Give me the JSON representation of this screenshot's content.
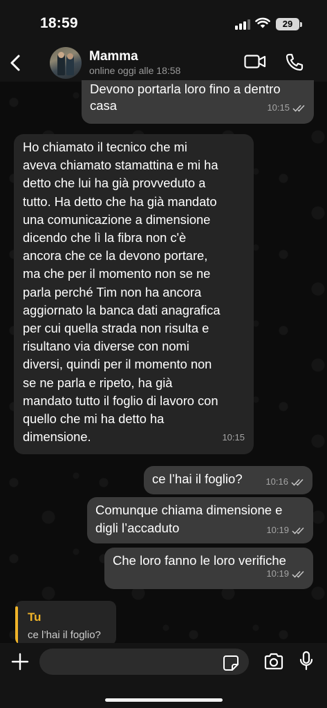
{
  "status_bar": {
    "time": "18:59",
    "battery": "29",
    "icons": [
      "signal-icon",
      "wifi-icon",
      "battery-icon"
    ]
  },
  "header": {
    "contact_name": "Mamma",
    "contact_status": "online oggi alle 18:58",
    "icons": [
      "back-icon",
      "avatar",
      "video-call-icon",
      "phone-call-icon"
    ]
  },
  "messages": [
    {
      "direction": "out",
      "lines": [
        "Devono portarla loro fino a dentro",
        "casa"
      ],
      "time": "10:15",
      "read": true
    },
    {
      "direction": "in",
      "lines": [
        "Ho chiamato il tecnico che mi",
        "aveva chiamato stamattina e mi ha",
        "detto che lui ha già provveduto a",
        "tutto. Ha detto che ha già mandato",
        "una comunicazione a dimensione",
        "dicendo che lì la fibra non c'è",
        "ancora che ce la devono portare,",
        "ma che per il momento non se ne",
        "parla perché Tim non ha ancora",
        "aggiornato la banca dati anagrafica",
        "per cui quella strada non risulta e",
        "risultano via diverse con nomi",
        "diversi, quindi per il momento non",
        "se ne parla e ripeto, ha già",
        "mandato tutto il foglio di lavoro con",
        "quello che mi ha detto ha",
        "dimensione."
      ],
      "time": "10:15"
    },
    {
      "direction": "out",
      "lines": [
        "ce l’hai il foglio?"
      ],
      "time": "10:16",
      "read": true
    },
    {
      "direction": "out",
      "lines": [
        "Comunque chiama dimensione e",
        "digli l’accaduto"
      ],
      "time": "10:19",
      "read": true
    },
    {
      "direction": "out",
      "lines": [
        "Che loro fanno le loro verifiche"
      ],
      "time": "10:19",
      "read": true
    }
  ],
  "reply_preview": {
    "author": "Tu",
    "text": "ce l’hai il foglio?",
    "accent_color": "#f0b429"
  },
  "input_bar": {
    "placeholder": "",
    "icons": [
      "plus-icon",
      "sticker-icon",
      "camera-icon",
      "microphone-icon"
    ]
  },
  "colors": {
    "outgoing_bubble": "#3b3b3b",
    "incoming_bubble": "#252525",
    "background": "#0c0c0c"
  }
}
